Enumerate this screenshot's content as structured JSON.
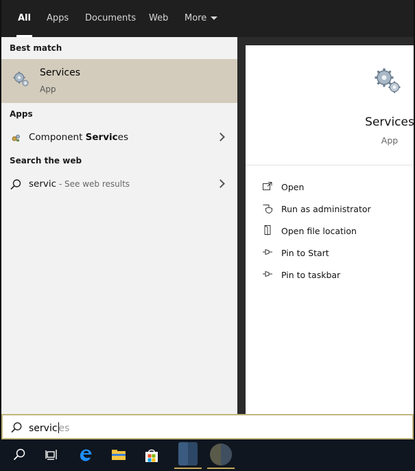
{
  "tabs": [
    {
      "label": "All",
      "active": true
    },
    {
      "label": "Apps"
    },
    {
      "label": "Documents"
    },
    {
      "label": "Web"
    },
    {
      "label": "More"
    }
  ],
  "left": {
    "best_match_header": "Best match",
    "best_match": {
      "title": "Services",
      "subtitle": "App",
      "icon": "services-gears-icon"
    },
    "apps_header": "Apps",
    "apps": [
      {
        "prefix": "Component ",
        "bold": "Servic",
        "suffix": "es",
        "icon": "component-services-icon"
      }
    ],
    "web_header": "Search the web",
    "web": [
      {
        "query": "servic",
        "hint": " - See web results",
        "icon": "search-icon"
      }
    ]
  },
  "preview": {
    "title": "Services",
    "subtitle": "App",
    "icon": "services-gears-icon",
    "actions": [
      {
        "label": "Open",
        "icon": "open-icon"
      },
      {
        "label": "Run as administrator",
        "icon": "shield-icon"
      },
      {
        "label": "Open file location",
        "icon": "folder-location-icon"
      },
      {
        "label": "Pin to Start",
        "icon": "pin-icon"
      },
      {
        "label": "Pin to taskbar",
        "icon": "pin-icon"
      }
    ]
  },
  "search": {
    "typed": "servic",
    "completion": "es",
    "icon": "search-icon"
  },
  "taskbar": {
    "items": [
      {
        "icon": "search-icon"
      },
      {
        "icon": "task-view-icon"
      },
      {
        "icon": "edge-browser-icon"
      },
      {
        "icon": "file-explorer-icon"
      },
      {
        "icon": "store-icon"
      },
      {
        "icon": "app-window-icon"
      },
      {
        "icon": "app-circle-icon"
      }
    ]
  },
  "colors": {
    "best_match_bg": "#d3ccbc",
    "search_border": "#c2b67d",
    "taskbar_bg": "#10161f"
  }
}
